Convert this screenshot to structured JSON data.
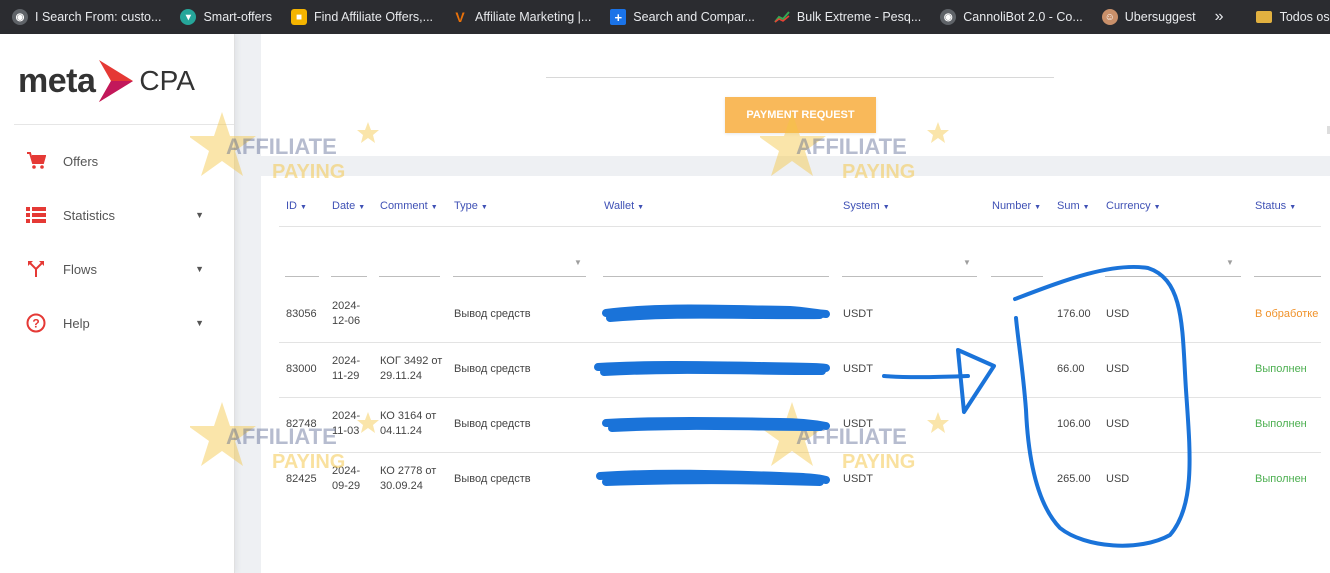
{
  "bookmarks": [
    {
      "label": "I Search From: custo...",
      "icon": "globe-icon",
      "color": "#9aa0a6"
    },
    {
      "label": "Smart-offers",
      "icon": "shirt-icon",
      "color": "#26a69a"
    },
    {
      "label": "Find Affiliate Offers,...",
      "icon": "square-yellow-icon",
      "color": "#f4b400"
    },
    {
      "label": "Affiliate Marketing |...",
      "icon": "v-logo-icon",
      "color": "#e8710a"
    },
    {
      "label": "Search and Compar...",
      "icon": "plus-icon",
      "color": "#1a73e8"
    },
    {
      "label": "Bulk Extreme - Pesq...",
      "icon": "chart-icon",
      "color": "#34a853"
    },
    {
      "label": "CannoliBot 2.0 - Co...",
      "icon": "globe-icon",
      "color": "#9aa0a6"
    },
    {
      "label": "Ubersuggest",
      "icon": "face-icon",
      "color": "#c9906a"
    }
  ],
  "bookmarks_more": "»",
  "bookmarks_folder": "Todos os favo",
  "logo": {
    "meta": "meta",
    "cpa": "CPA"
  },
  "nav": [
    {
      "label": "Offers",
      "icon": "cart-icon",
      "caret": ""
    },
    {
      "label": "Statistics",
      "icon": "list-icon",
      "caret": "▼"
    },
    {
      "label": "Flows",
      "icon": "split-icon",
      "caret": "▼"
    },
    {
      "label": "Help",
      "icon": "help-icon",
      "caret": "▼"
    }
  ],
  "payment_request_label": "PAYMENT REQUEST",
  "table": {
    "columns": [
      "ID",
      "Date",
      "Comment",
      "Type",
      "Wallet",
      "System",
      "Number",
      "Sum",
      "Currency",
      "Status"
    ],
    "rows": [
      {
        "id": "83056",
        "date": "2024-12-06",
        "comment": "",
        "type": "Вывод средств",
        "wallet": "",
        "system": "USDT",
        "number": "",
        "sum": "176.00",
        "currency": "USD",
        "status": "В обработке"
      },
      {
        "id": "83000",
        "date": "2024-11-29",
        "comment": "КОГ 3492 от 29.11.24",
        "type": "Вывод средств",
        "wallet": "",
        "system": "USDT",
        "number": "",
        "sum": "66.00",
        "currency": "USD",
        "status": "Выполнен"
      },
      {
        "id": "82748",
        "date": "2024-11-03",
        "comment": "КО 3164 от 04.11.24",
        "type": "Вывод средств",
        "wallet": "",
        "system": "USDT",
        "number": "",
        "sum": "106.00",
        "currency": "USD",
        "status": "Выполнен"
      },
      {
        "id": "82425",
        "date": "2024-09-29",
        "comment": "КО 2778 от 30.09.24",
        "type": "Вывод средств",
        "wallet": "",
        "system": "USDT",
        "number": "",
        "sum": "265.00",
        "currency": "USD",
        "status": "Выполнен"
      }
    ]
  },
  "watermark": {
    "line1": "AFFILIATE",
    "line2": "PAYING"
  },
  "colors": {
    "accent": "#3f51b5",
    "button": "#f9b95a",
    "processing": "#f0922a",
    "done": "#4caf50",
    "scribble": "#1a73d9"
  }
}
